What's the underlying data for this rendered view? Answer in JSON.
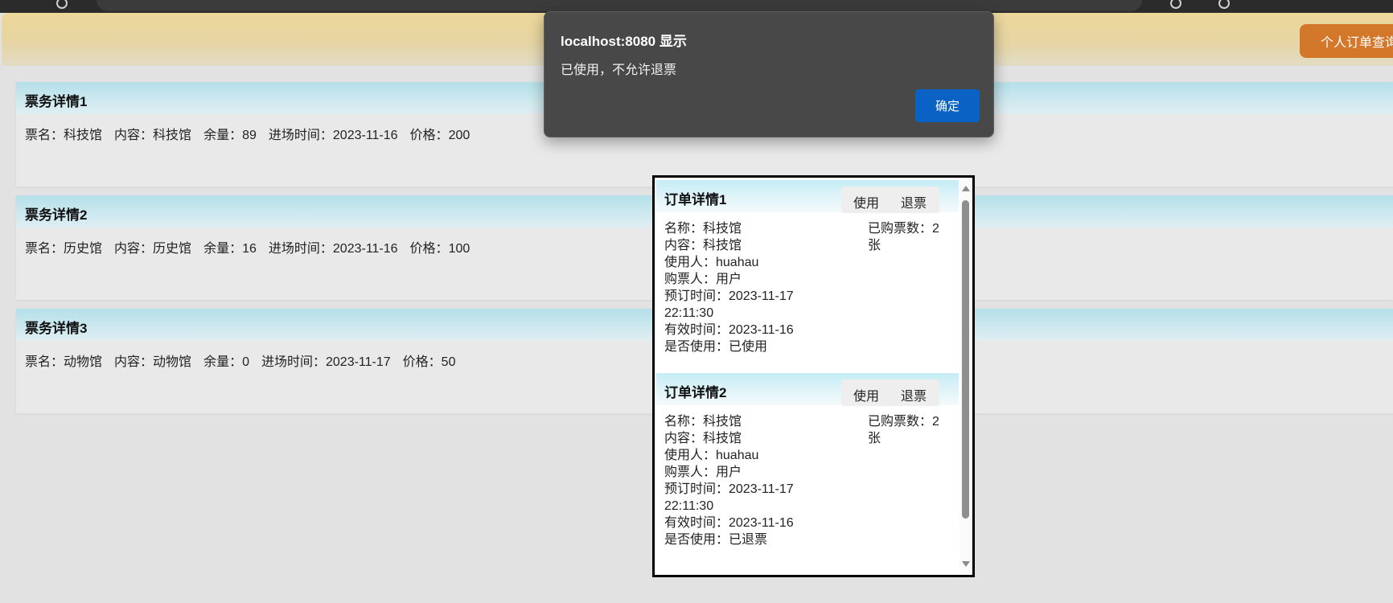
{
  "header": {
    "order_query_label": "个人订单查询"
  },
  "tickets": [
    {
      "title": "票务详情1",
      "name_label": "票名：",
      "name": "科技馆",
      "content_label": "内容：",
      "content": "科技馆",
      "remaining_label": "余量：",
      "remaining": "89",
      "entry_time_label": "进场时间：",
      "entry_time": "2023-11-16",
      "price_label": "价格：",
      "price": "200"
    },
    {
      "title": "票务详情2",
      "name_label": "票名：",
      "name": "历史馆",
      "content_label": "内容：",
      "content": "历史馆",
      "remaining_label": "余量：",
      "remaining": "16",
      "entry_time_label": "进场时间：",
      "entry_time": "2023-11-16",
      "price_label": "价格：",
      "price": "100"
    },
    {
      "title": "票务详情3",
      "name_label": "票名：",
      "name": "动物馆",
      "content_label": "内容：",
      "content": "动物馆",
      "remaining_label": "余量：",
      "remaining": "0",
      "entry_time_label": "进场时间：",
      "entry_time": "2023-11-17",
      "price_label": "价格：",
      "price": "50"
    }
  ],
  "alert": {
    "title": "localhost:8080 显示",
    "message": "已使用，不允许退票",
    "ok_label": "确定"
  },
  "orders": [
    {
      "title": "订单详情1",
      "use_label": "使用",
      "refund_label": "退票",
      "name_line": "名称：科技馆",
      "content_line": "内容：科技馆",
      "user_line": "使用人：huahau",
      "buyer_line": "购票人：用户",
      "booking_time_line": "预订时间：2023-11-17 22:11:30",
      "valid_time_line": "有效时间：2023-11-16",
      "used_line": "是否使用：已使用",
      "purchased_line": "已购票数：2张"
    },
    {
      "title": "订单详情2",
      "use_label": "使用",
      "refund_label": "退票",
      "name_line": "名称：科技馆",
      "content_line": "内容：科技馆",
      "user_line": "使用人：huahau",
      "buyer_line": "购票人：用户",
      "booking_time_line": "预订时间：2023-11-17 22:11:30",
      "valid_time_line": "有效时间：2023-11-16",
      "used_line": "是否使用：已退票",
      "purchased_line": "已购票数：2张"
    }
  ],
  "colors": {
    "accent_orange": "#d3782a",
    "dialog_button_blue": "#0a63c4",
    "dialog_background": "#484848"
  }
}
